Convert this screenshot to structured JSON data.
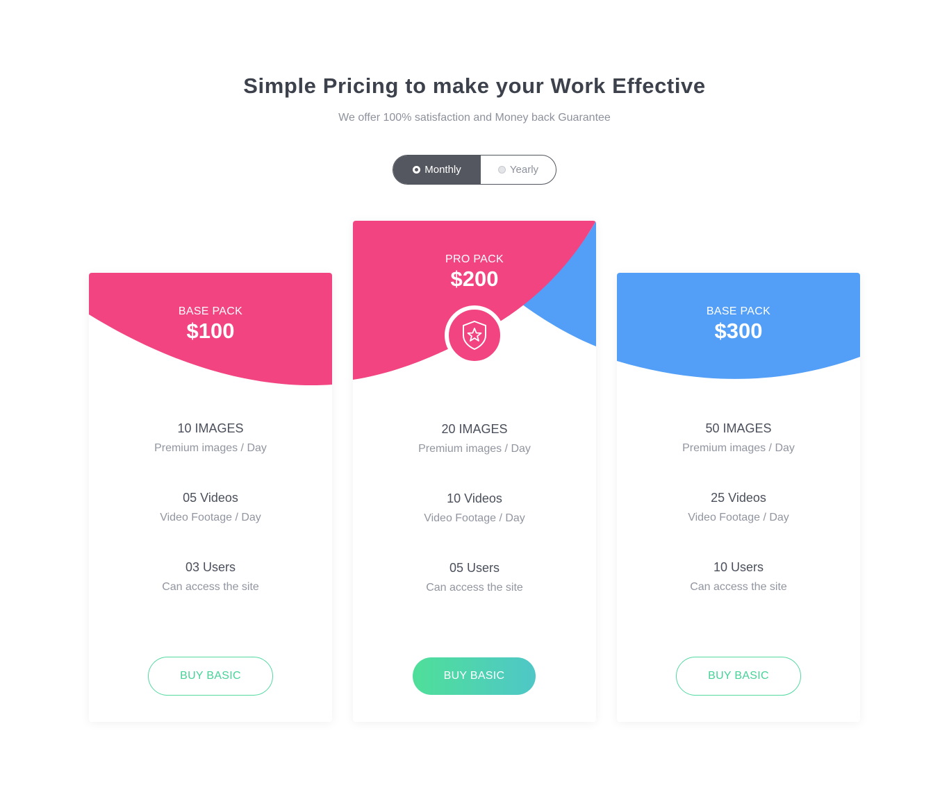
{
  "header": {
    "title": "Simple Pricing to make your Work Effective",
    "subtitle": "We offer 100% satisfaction and Money back Guarantee"
  },
  "billing_toggle": {
    "options": [
      {
        "label": "Monthly",
        "selected": true
      },
      {
        "label": "Yearly",
        "selected": false
      }
    ]
  },
  "colors": {
    "pink": "#f24480",
    "blue": "#539ff7",
    "green_start": "#4fdf99",
    "green_end": "#4fc7c7",
    "toggle_active": "#54575f"
  },
  "plans": [
    {
      "name": "BASE PACK",
      "price": "$100",
      "features": [
        {
          "title": "10 IMAGES",
          "desc": "Premium images / Day"
        },
        {
          "title": "05 Videos",
          "desc": "Video Footage / Day"
        },
        {
          "title": "03 Users",
          "desc": "Can access the site"
        }
      ],
      "button": "BUY BASIC"
    },
    {
      "name": "PRO PACK",
      "price": "$200",
      "badge_icon": "shield-star-icon",
      "features": [
        {
          "title": "20 IMAGES",
          "desc": "Premium images / Day"
        },
        {
          "title": "10 Videos",
          "desc": "Video Footage / Day"
        },
        {
          "title": "05 Users",
          "desc": "Can access the site"
        }
      ],
      "button": "BUY BASIC"
    },
    {
      "name": "BASE PACK",
      "price": "$300",
      "features": [
        {
          "title": "50 IMAGES",
          "desc": "Premium images / Day"
        },
        {
          "title": "25 Videos",
          "desc": "Video Footage / Day"
        },
        {
          "title": "10 Users",
          "desc": "Can access the site"
        }
      ],
      "button": "BUY BASIC"
    }
  ]
}
